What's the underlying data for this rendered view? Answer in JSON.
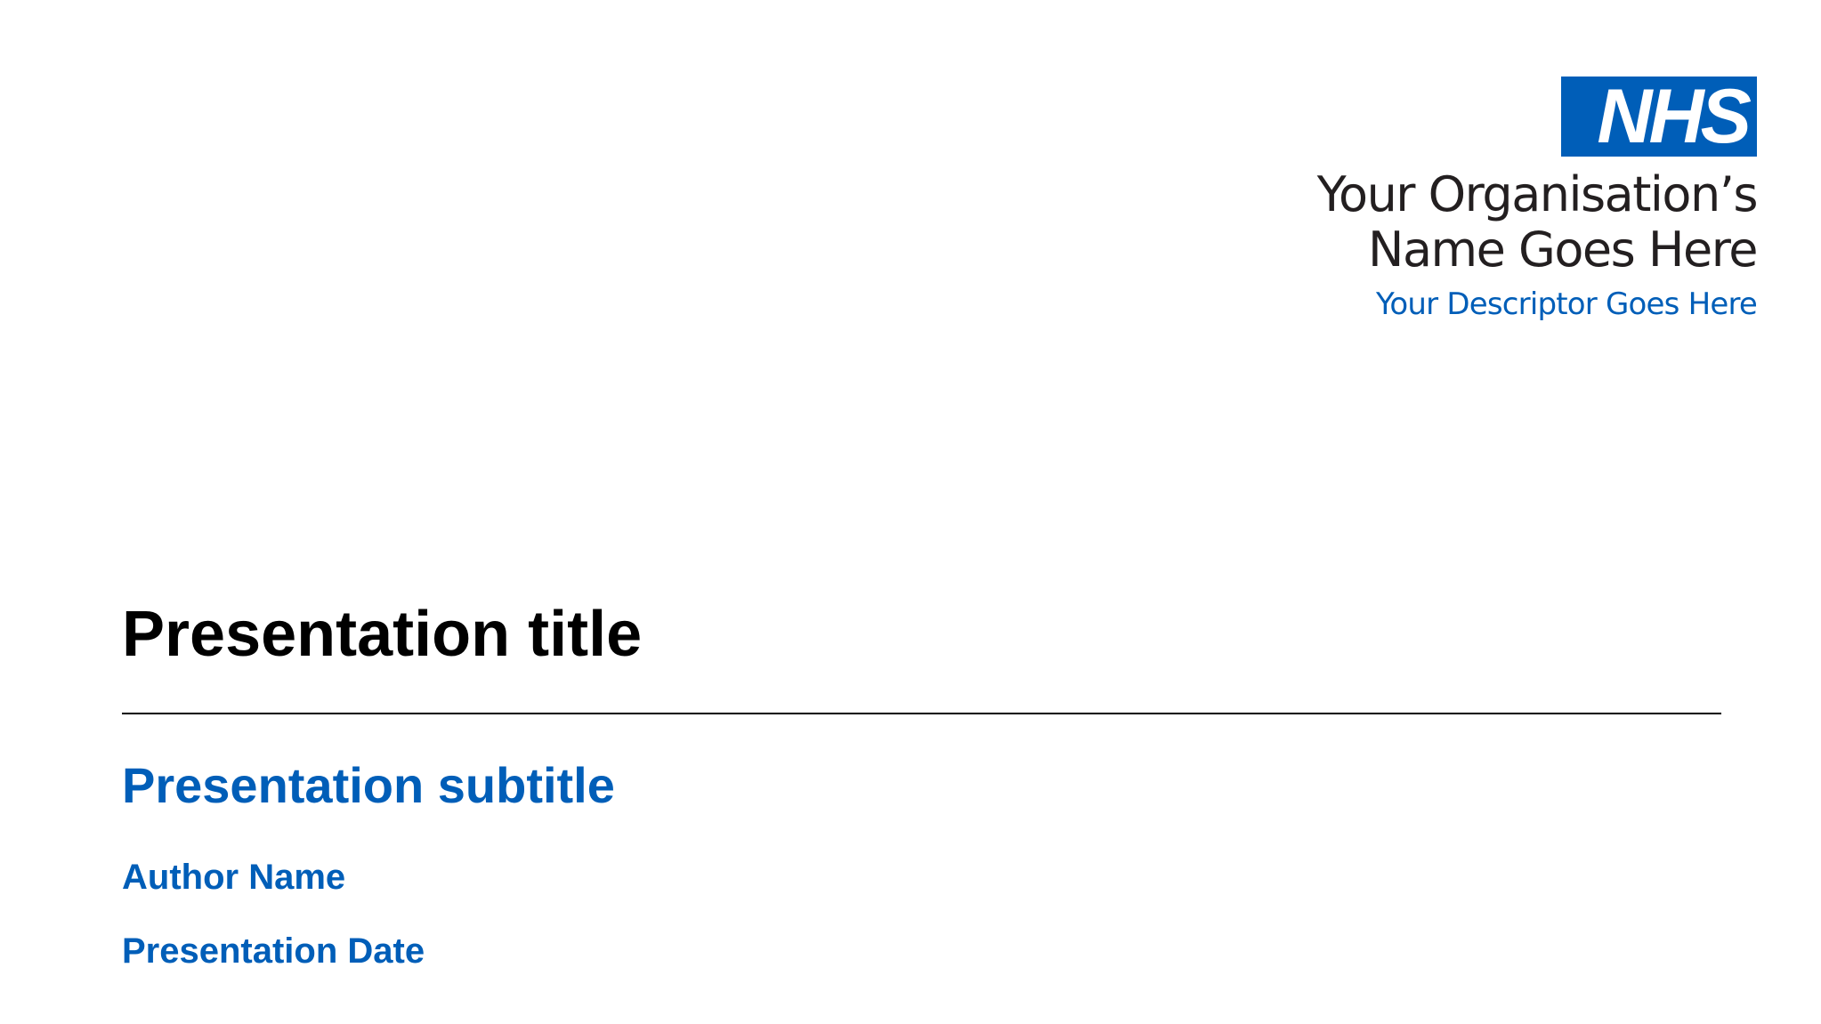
{
  "logo": {
    "text": "NHS",
    "color": "#005EB8"
  },
  "organisation": {
    "name_line1": "Your Organisation’s",
    "name_line2": "Name Goes Here",
    "descriptor": "Your Descriptor Goes Here"
  },
  "slide": {
    "title": "Presentation title",
    "subtitle": "Presentation subtitle",
    "author": "Author Name",
    "date": "Presentation Date"
  },
  "colors": {
    "title": "#000000",
    "accent": "#005EB8",
    "background": "#ffffff"
  }
}
